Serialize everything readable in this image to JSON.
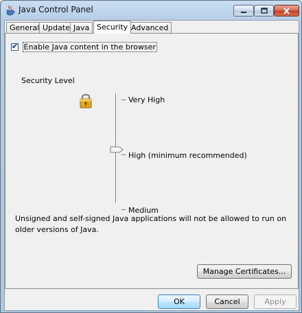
{
  "window": {
    "title": "Java Control Panel",
    "icon": "java-cup-icon"
  },
  "title_buttons": [
    "minimize-icon",
    "maximize-icon",
    "close-icon"
  ],
  "tabs": [
    {
      "label": "General"
    },
    {
      "label": "Update"
    },
    {
      "label": "Java"
    },
    {
      "label": "Security",
      "active": true
    },
    {
      "label": "Advanced"
    }
  ],
  "security": {
    "enable_checkbox": {
      "label": "Enable Java content in the browser",
      "checked": true
    },
    "level_heading": "Security Level",
    "lock_icon": "padlock-icon",
    "levels": [
      "Very High",
      "High (minimum recommended)",
      "Medium"
    ],
    "selected_level": "High (minimum recommended)",
    "description": "Unsigned and self-signed Java applications will not be allowed to run on older versions of Java.",
    "manage_button": "Manage Certificates..."
  },
  "footer": {
    "ok": "OK",
    "cancel": "Cancel",
    "apply": "Apply",
    "apply_enabled": false
  },
  "colors": {
    "title_bar": "#b5cde6",
    "close_button": "#c03e25",
    "panel_bg": "#f0f0f0",
    "ok_button_border": "#3c7fb1"
  }
}
